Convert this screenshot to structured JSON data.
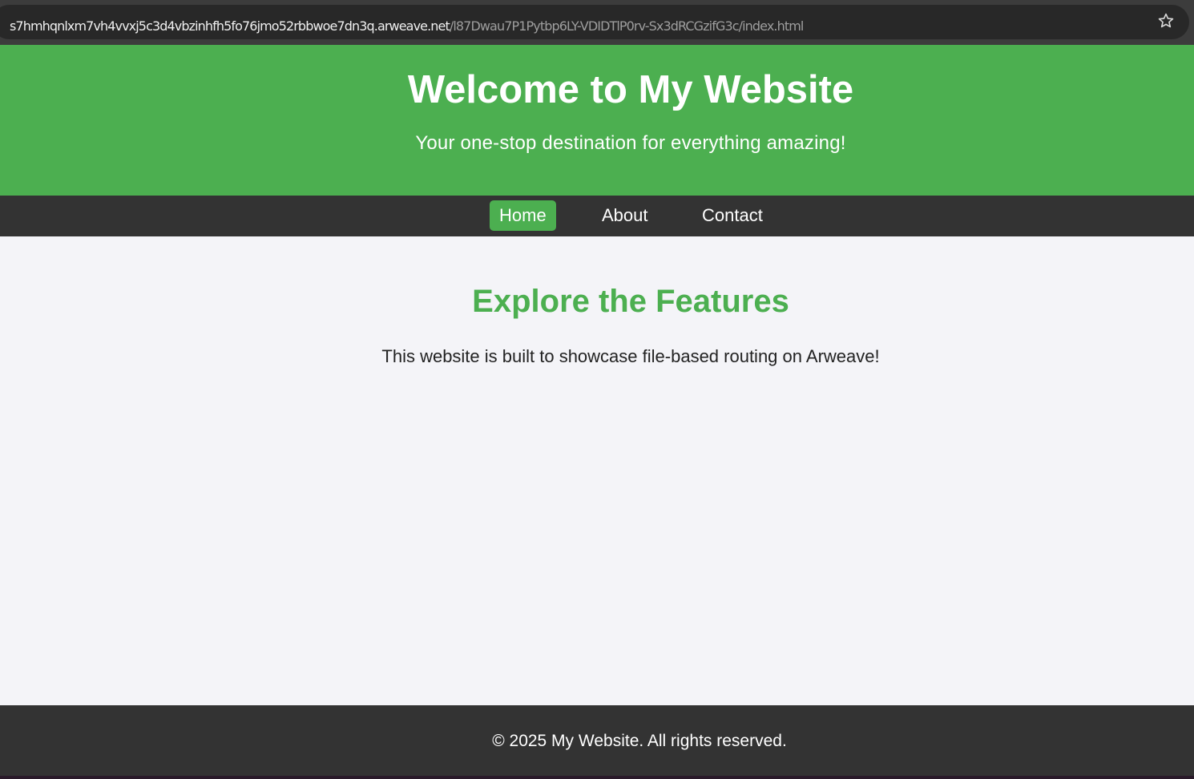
{
  "browser": {
    "url_host": "s7hmhqnlxm7vh4vvxj5c3d4vbzinhfh5fo76jmo52rbbwoe7dn3q.arweave.net",
    "url_path": "/l87Dwau7P1Pytbp6LY-VDIDTlP0rv-Sx3dRCGzifG3c/index.html",
    "icons": [
      "site-info-icon",
      "bookmark-star-icon"
    ]
  },
  "header": {
    "title": "Welcome to My Website",
    "tagline": "Your one-stop destination for everything amazing!"
  },
  "nav": {
    "items": [
      {
        "label": "Home",
        "active": true
      },
      {
        "label": "About",
        "active": false
      },
      {
        "label": "Contact",
        "active": false
      }
    ]
  },
  "main": {
    "heading": "Explore the Features",
    "text": "This website is built to showcase file-based routing on Arweave!"
  },
  "footer": {
    "text": "© 2025 My Website. All rights reserved."
  },
  "colors": {
    "brand_green": "#4caf50",
    "dark_bar": "#333333",
    "page_background": "#f4f4f8"
  }
}
